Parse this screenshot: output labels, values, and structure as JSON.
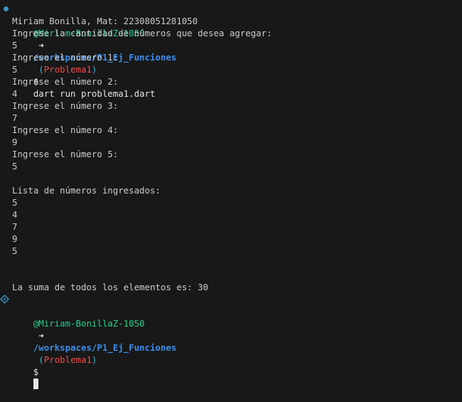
{
  "terminal": {
    "prompt": {
      "user": "@Miriam-BonillaZ-1050",
      "arrow": "➜",
      "path": "/workspaces/P1_Ej_Funciones",
      "branch_open": "(",
      "branch": "Problema1",
      "branch_close": ")",
      "dollar": "$"
    },
    "command": "dart run problema1.dart",
    "output": [
      "Miriam Bonilla, Mat: 22308051281050",
      "Ingrese la cantidad de números que desea agregar:",
      "5",
      "Ingrese el número 1:",
      "5",
      "Ingrese el número 2:",
      "4",
      "Ingrese el número 3:",
      "7",
      "Ingrese el número 4:",
      "9",
      "Ingrese el número 5:",
      "5",
      "",
      "Lista de números ingresados:",
      "5",
      "4",
      "7",
      "9",
      "5",
      "",
      "",
      "La suma de todos los elementos es: 30"
    ]
  },
  "colors": {
    "background": "#181818",
    "text": "#cccccc",
    "user": "#23d18b",
    "path": "#3b8eea",
    "branch": "#f14c4c",
    "paren": "#29b8db",
    "status_dot": "#3a94c5"
  }
}
